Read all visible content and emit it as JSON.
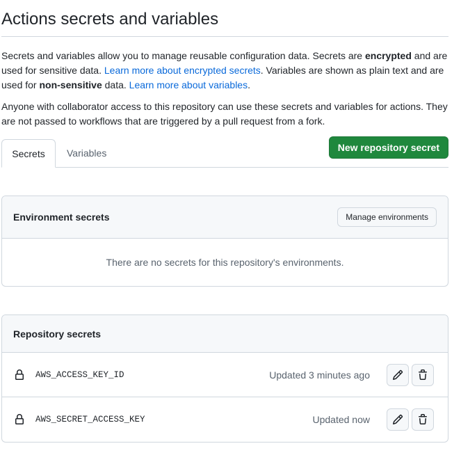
{
  "page": {
    "title": "Actions secrets and variables"
  },
  "intro": {
    "p1_part1": "Secrets and variables allow you to manage reusable configuration data. Secrets are ",
    "p1_bold1": "encrypted",
    "p1_part2": " and are used for sensitive data. ",
    "p1_link1": "Learn more about encrypted secrets",
    "p1_part3": ". Variables are shown as plain text and are used for ",
    "p1_bold2": "non-sensitive",
    "p1_part4": " data. ",
    "p1_link2": "Learn more about variables",
    "p1_part5": ".",
    "p2": "Anyone with collaborator access to this repository can use these secrets and variables for actions. They are not passed to workflows that are triggered by a pull request from a fork."
  },
  "tabs": [
    {
      "label": "Secrets",
      "selected": true
    },
    {
      "label": "Variables",
      "selected": false
    }
  ],
  "new_secret_button": "New repository secret",
  "environment_secrets": {
    "title": "Environment secrets",
    "manage_button": "Manage environments",
    "empty_message": "There are no secrets for this repository's environments."
  },
  "repository_secrets": {
    "title": "Repository secrets",
    "rows": [
      {
        "name": "AWS_ACCESS_KEY_ID",
        "updated": "Updated 3 minutes ago",
        "icon": "lock-icon"
      },
      {
        "name": "AWS_SECRET_ACCESS_KEY",
        "updated": "Updated now",
        "icon": "lock-icon"
      }
    ]
  },
  "colors": {
    "primary_button": "#1f883d",
    "link": "#0969da",
    "border": "#d0d7de",
    "muted_text": "#59636e",
    "header_bg": "#f6f8fa"
  }
}
